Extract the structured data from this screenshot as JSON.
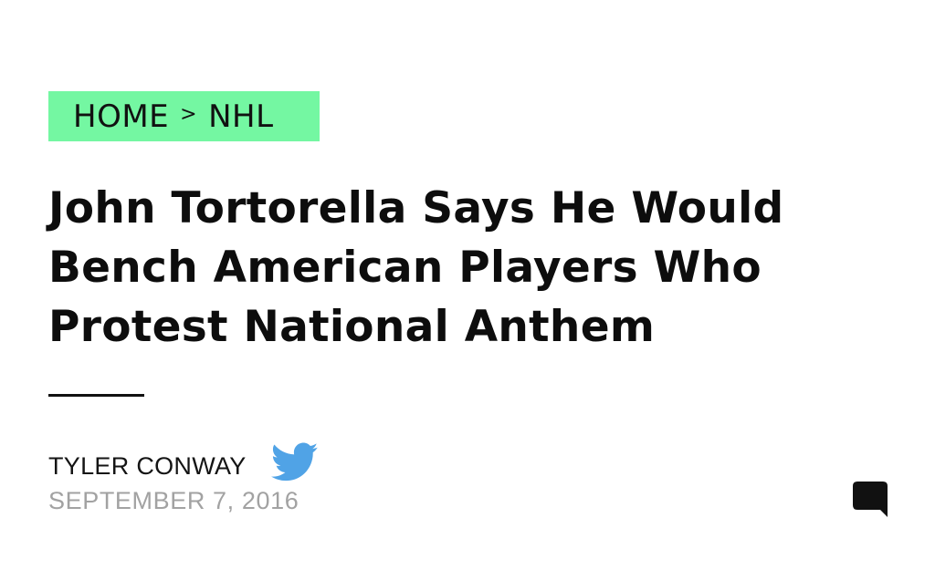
{
  "breadcrumb": {
    "home": "HOME",
    "separator": ">",
    "section": "NHL",
    "background": "#74f7a2"
  },
  "article": {
    "headline": "John Tortorella Says He Would Bench American Players Who Protest National Anthem",
    "author": "TYLER CONWAY",
    "date": "SEPTEMBER 7, 2016"
  },
  "icons": {
    "author_social": "twitter-bird-icon",
    "comments": "comment-bubble-icon"
  },
  "colors": {
    "twitter": "#50a3e6",
    "date_text": "#a2a2a2",
    "headline_text": "#0d0d0d"
  }
}
